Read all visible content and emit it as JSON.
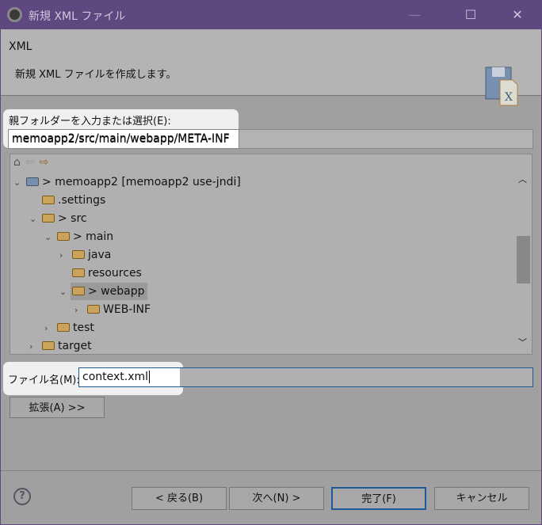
{
  "window": {
    "title": "新規 XML ファイル",
    "minimize": "—",
    "maximize": "☐",
    "close": "✕"
  },
  "header": {
    "title": "XML",
    "description": "新規 XML ファイルを作成します。"
  },
  "parent_folder": {
    "label": "親フォルダーを入力または選択(E):",
    "value": "memoapp2/src/main/webapp/META-INF"
  },
  "tree": {
    "nav": {
      "home": "⌂",
      "back": "⇦",
      "forward": "⇨"
    },
    "items": [
      {
        "label": "> memoapp2 [memoapp2 use-jndi]",
        "twisty": "⌄"
      },
      {
        "label": ".settings",
        "twisty": ""
      },
      {
        "label": "> src",
        "twisty": "⌄"
      },
      {
        "label": "> main",
        "twisty": "⌄"
      },
      {
        "label": "java",
        "twisty": "›"
      },
      {
        "label": "resources",
        "twisty": ""
      },
      {
        "label": "> webapp",
        "twisty": "⌄"
      },
      {
        "label": "WEB-INF",
        "twisty": "›"
      },
      {
        "label": "test",
        "twisty": "›"
      },
      {
        "label": "target",
        "twisty": "›"
      }
    ]
  },
  "file_name": {
    "label": "ファイル名(M):",
    "value": "context.xml"
  },
  "buttons": {
    "advanced": "拡張(A) >>",
    "back": "< 戻る(B)",
    "next": "次へ(N) >",
    "finish": "完了(F)",
    "cancel": "キャンセル",
    "help": "?"
  }
}
